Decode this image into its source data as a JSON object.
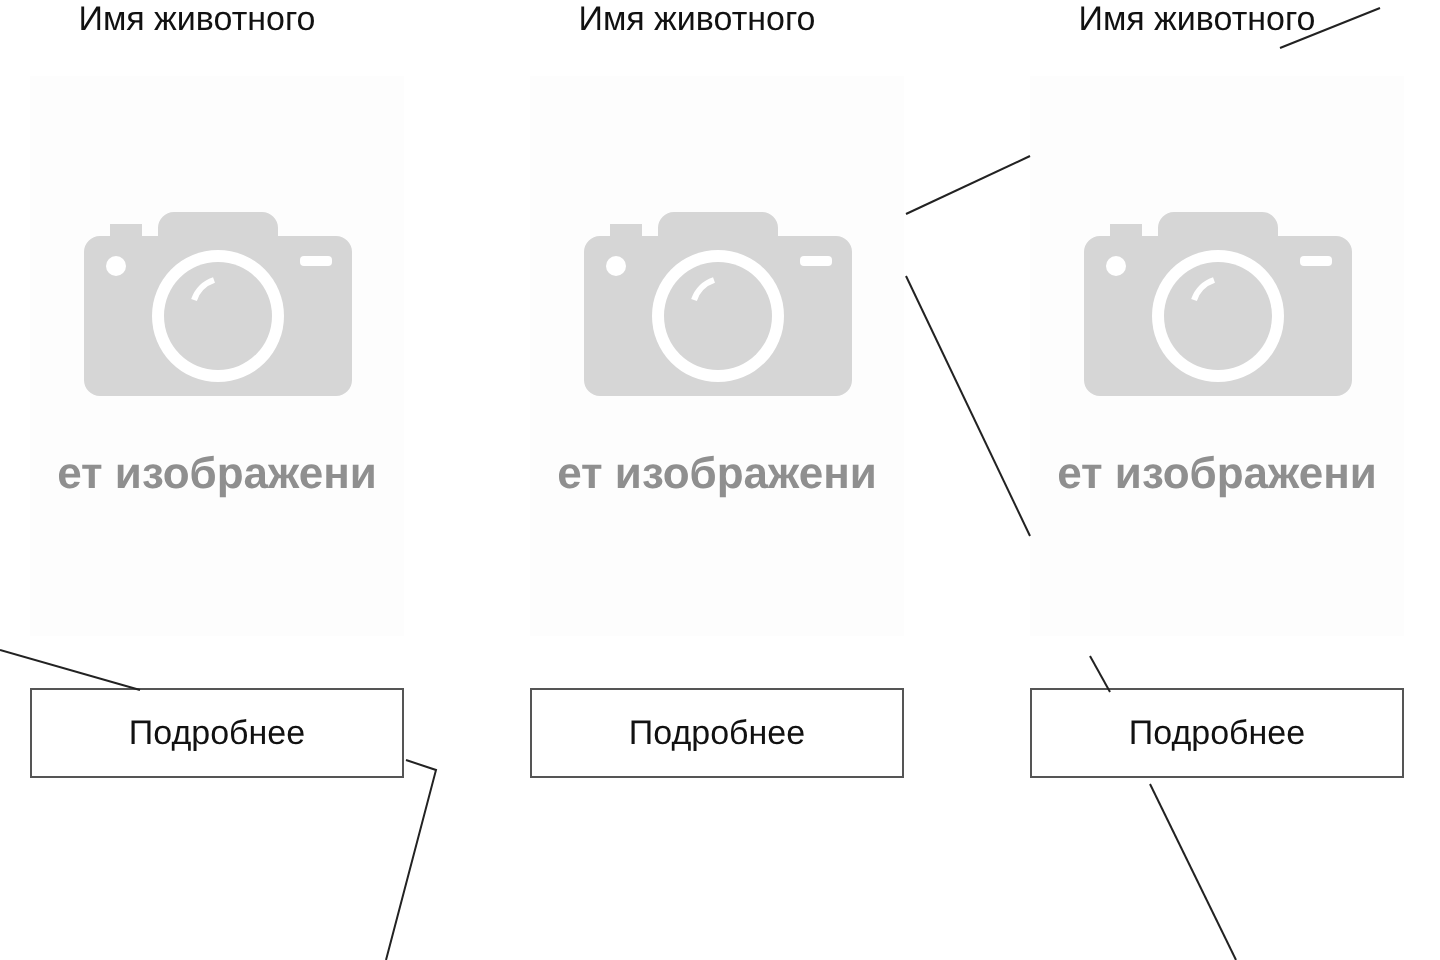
{
  "cards": [
    {
      "title": "Имя животного",
      "placeholder_text": "ет изображени",
      "button": "Подробнее"
    },
    {
      "title": "Имя животного",
      "placeholder_text": "ет изображени",
      "button": "Подробнее"
    },
    {
      "title": "Имя животного",
      "placeholder_text": "ет изображени",
      "button": "Подробнее"
    }
  ]
}
